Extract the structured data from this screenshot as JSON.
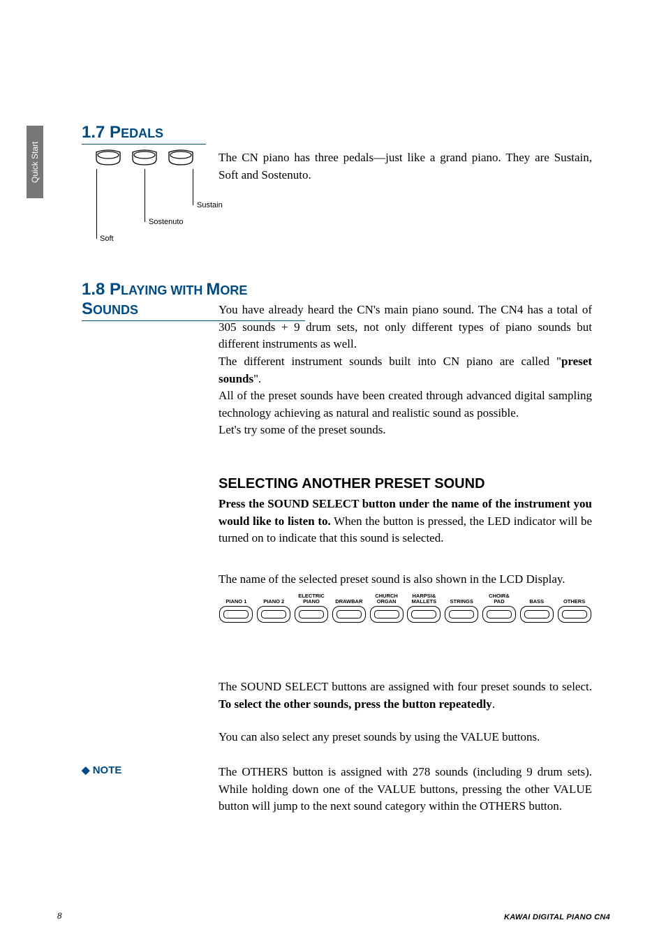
{
  "side_tab": "Quick Start",
  "section_17": {
    "number": "1.7",
    "title_main": "P",
    "title_sc": "EDALS",
    "body": "The CN piano has three pedals—just like a grand piano.  They are Sustain, Soft and Sostenuto.",
    "pedal_labels": {
      "soft": "Soft",
      "sostenuto": "Sostenuto",
      "sustain": "Sustain"
    }
  },
  "section_18": {
    "number": "1.8",
    "title_main": "P",
    "title_sc1": "LAYING",
    "title_mid": " WITH ",
    "title_main2": "M",
    "title_sc2": "ORE",
    "title_main3": " S",
    "title_sc3": "OUNDS",
    "para1a": "You have already heard the CN's main piano sound.  The CN4 has a total of 305 sounds + 9 drum sets, not only different types of piano sounds but different instruments as well.",
    "para1b_pre": "The different instrument sounds built into CN piano are called \"",
    "para1b_bold": "preset sounds",
    "para1b_post": "\".",
    "para1c": "All of the preset sounds have been created through advanced digital sampling technology achieving as natural and realistic sound as possible.",
    "para1d": "Let's try some of the preset sounds.",
    "subheading": "SELECTING ANOTHER PRESET SOUND",
    "para2a_bold": "Press the SOUND SELECT button under the name of the instrument you would like to listen to.",
    "para2a_rest": "  When the button is pressed, the LED indicator will be turned on to indicate that this sound is selected.",
    "para2b": "The name of the selected preset sound is also shown in the LCD Display.",
    "sound_buttons": [
      "PIANO 1",
      "PIANO 2",
      "ELECTRIC\nPIANO",
      "DRAWBAR",
      "CHURCH\nORGAN",
      "HARPSI&\nMALLETS",
      "STRINGS",
      "CHOIR&\nPAD",
      "BASS",
      "OTHERS"
    ],
    "para3a_pre": "The SOUND SELECT buttons are assigned with four preset sounds to select.  ",
    "para3a_bold": "To select the other sounds, press the button repeatedly",
    "para3a_post": ".",
    "para3b": "You can also select any preset sounds by using the VALUE buttons.",
    "note_label": "NOTE",
    "note_body": "The OTHERS button is assigned with 278 sounds (including 9 drum sets). While holding down one of the VALUE buttons, pressing the other VALUE button will jump to the next sound category within the OTHERS button."
  },
  "footer": {
    "page": "8",
    "product": "KAWAI DIGITAL PIANO CN4"
  }
}
